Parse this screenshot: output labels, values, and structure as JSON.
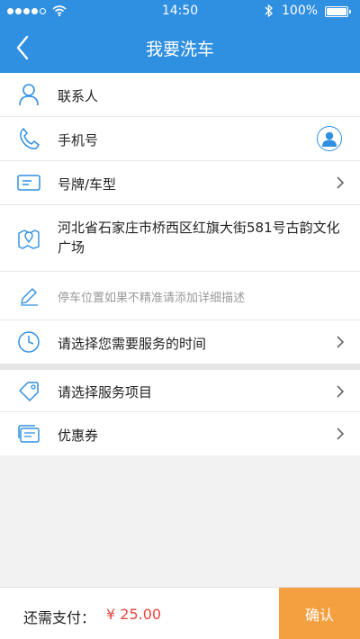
{
  "status_bar": {
    "time": "14:50",
    "battery": "100%"
  },
  "nav": {
    "title": "我要洗车"
  },
  "form": {
    "contact": "联系人",
    "phone": "手机号",
    "plate": "号牌/车型",
    "address": "河北省石家庄市桥西区红旗大街581号古韵文化广场",
    "parking_hint": "停车位置如果不精准请添加详细描述",
    "time": "请选择您需要服务的时间",
    "service": "请选择服务项目",
    "coupon": "优惠券"
  },
  "footer": {
    "pay_label": "还需支付：",
    "amount": "¥ 25.00",
    "confirm": "确认"
  },
  "colors": {
    "primary": "#2f8fe1",
    "accent": "#f5a040",
    "price": "#e8453c"
  }
}
